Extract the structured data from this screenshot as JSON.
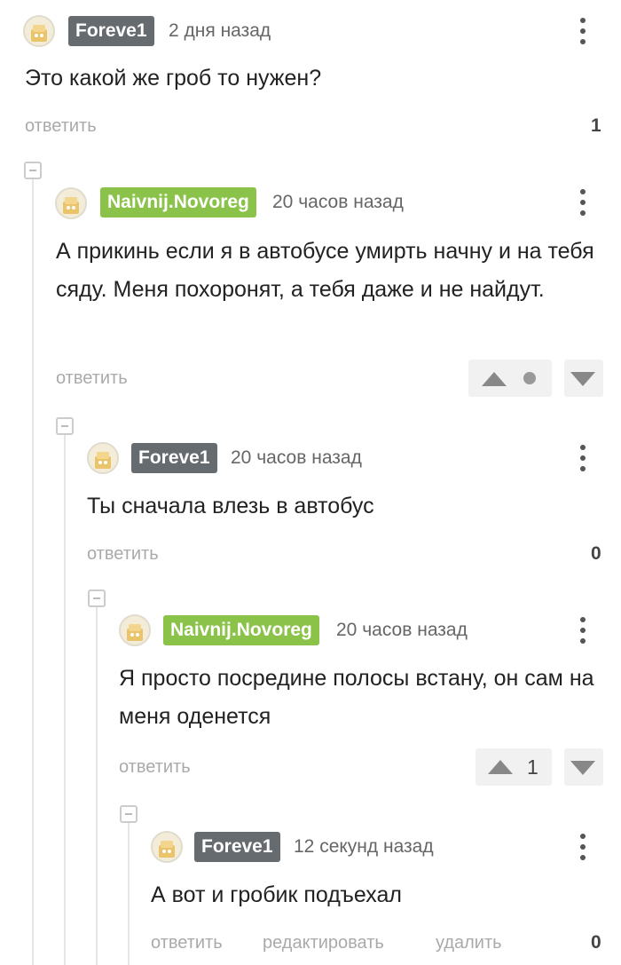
{
  "comments": [
    {
      "author": "Foreve1",
      "time": "2 дня назад",
      "text": "Это какой же гроб то нужен?",
      "reply_label": "ответить",
      "rating": "1"
    },
    {
      "author": "Naivnij.Novoreg",
      "time": "20 часов назад",
      "text": "А прикинь если я в автобусе умирть начну и на тебя сяду. Меня похоронят, а тебя даже и не найдут.",
      "reply_label": "ответить"
    },
    {
      "author": "Foreve1",
      "time": "20 часов назад",
      "text": "Ты сначала влезь в автобус",
      "reply_label": "ответить",
      "rating": "0"
    },
    {
      "author": "Naivnij.Novoreg",
      "time": "20 часов назад",
      "text": "Я просто посредине полосы встану, он сам на меня оденется",
      "reply_label": "ответить",
      "vote_count": "1"
    },
    {
      "author": "Foreve1",
      "time": "12 секунд назад",
      "text": "А вот и гробик подъехал",
      "reply_label": "ответить",
      "edit_label": "редактировать",
      "delete_label": "удалить",
      "rating": "0"
    }
  ],
  "colors": {
    "nick_gray": "#666b70",
    "nick_green": "#8bc34a",
    "action_text": "#aaaaaa",
    "thread_line": "#e5e5e5"
  },
  "icons": {
    "avatar": "default-avatar-icon",
    "menu": "kebab-menu-icon",
    "collapse": "collapse-minus-icon",
    "upvote": "upvote-triangle-icon",
    "downvote": "downvote-triangle-icon"
  }
}
